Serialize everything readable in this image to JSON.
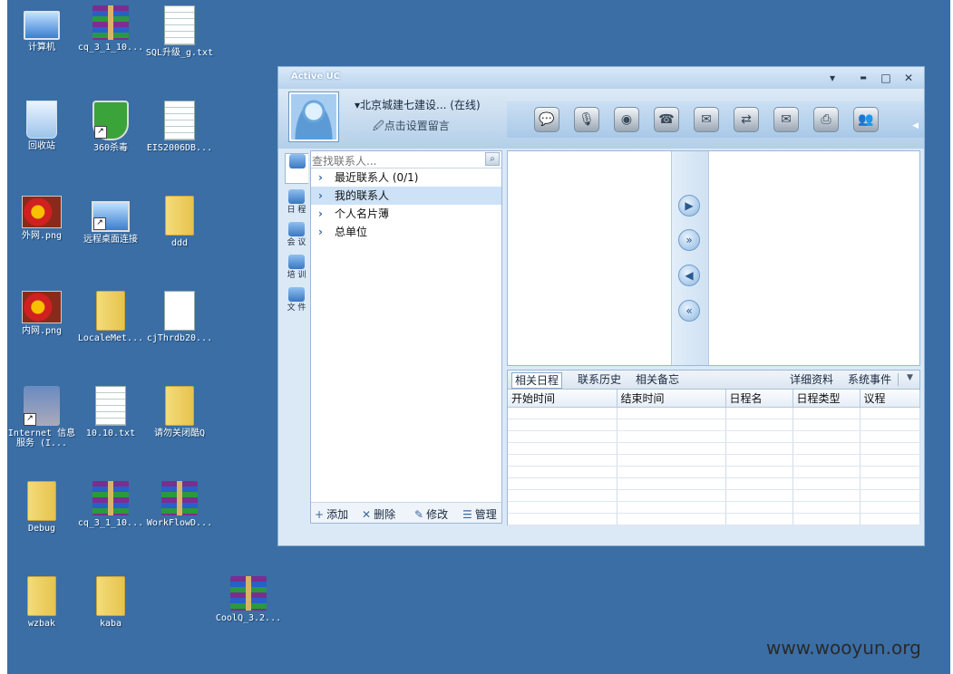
{
  "desktop": {
    "icons": [
      {
        "label": "计算机",
        "type": "computer"
      },
      {
        "label": "cq_3_1_10...",
        "type": "rar"
      },
      {
        "label": "SQL升级_g.txt",
        "type": "doc"
      },
      {
        "label": "回收站",
        "type": "recycle"
      },
      {
        "label": "360杀毒",
        "type": "shield"
      },
      {
        "label": "EIS2006DB...",
        "type": "doc"
      },
      {
        "label": "外网.png",
        "type": "flower"
      },
      {
        "label": "远程桌面连接",
        "type": "remote"
      },
      {
        "label": "ddd",
        "type": "folder"
      },
      {
        "label": "内网.png",
        "type": "flower"
      },
      {
        "label": "LocaleMet...",
        "type": "folder"
      },
      {
        "label": "cjThrdb20...",
        "type": "doc"
      },
      {
        "label": "Internet 信息服务 (I...",
        "type": "iis"
      },
      {
        "label": "10.10.txt",
        "type": "doc"
      },
      {
        "label": "请勿关闭酷Q",
        "type": "folder"
      },
      {
        "label": "Debug",
        "type": "folder"
      },
      {
        "label": "cq_3_1_10...",
        "type": "rar"
      },
      {
        "label": "WorkFlowD...",
        "type": "rar"
      },
      {
        "label": "wzbak",
        "type": "folder"
      },
      {
        "label": "kaba",
        "type": "folder"
      },
      {
        "label": "CoolQ_3.2...",
        "type": "rar"
      }
    ],
    "watermark": "www.wooyun.org"
  },
  "window": {
    "title": "Active UC",
    "controls": {
      "menu": "▾",
      "minimize": "▬",
      "maximize": "□",
      "close": "✕"
    },
    "user": {
      "name": "▾北京城建七建设...  (在线)",
      "message": "🖉点击设置留言"
    },
    "toolbar_icons": [
      "chat-icon",
      "broadcast-icon",
      "webcam-icon",
      "phone-icon",
      "sms-icon",
      "transfer-icon",
      "mail-icon",
      "print-icon",
      "group-icon"
    ],
    "sidebar": [
      {
        "label": "",
        "icon": "contacts-icon"
      },
      {
        "label": "日 程",
        "icon": "schedule-icon"
      },
      {
        "label": "会 议",
        "icon": "meeting-icon"
      },
      {
        "label": "培 训",
        "icon": "training-icon"
      },
      {
        "label": "文 件",
        "icon": "file-icon"
      }
    ],
    "contacts": {
      "search_placeholder": "查找联系人...",
      "nodes": [
        {
          "label": "最近联系人 (0/1)",
          "selected": false
        },
        {
          "label": "我的联系人",
          "selected": true
        },
        {
          "label": "个人名片薄",
          "selected": false
        },
        {
          "label": "总单位",
          "selected": false
        }
      ],
      "footer": [
        {
          "glyph": "+",
          "label": "添加"
        },
        {
          "glyph": "✕",
          "label": "删除"
        },
        {
          "glyph": "✎",
          "label": "修改"
        },
        {
          "glyph": "☰",
          "label": "管理"
        }
      ]
    },
    "details": {
      "tabs": [
        "相关日程",
        "联系历史",
        "相关备忘"
      ],
      "right_tabs": [
        "详细资料",
        "系统事件"
      ],
      "columns": [
        "开始时间",
        "结束时间",
        "日程名",
        "日程类型",
        "议程"
      ],
      "empty_rows": 10
    }
  }
}
